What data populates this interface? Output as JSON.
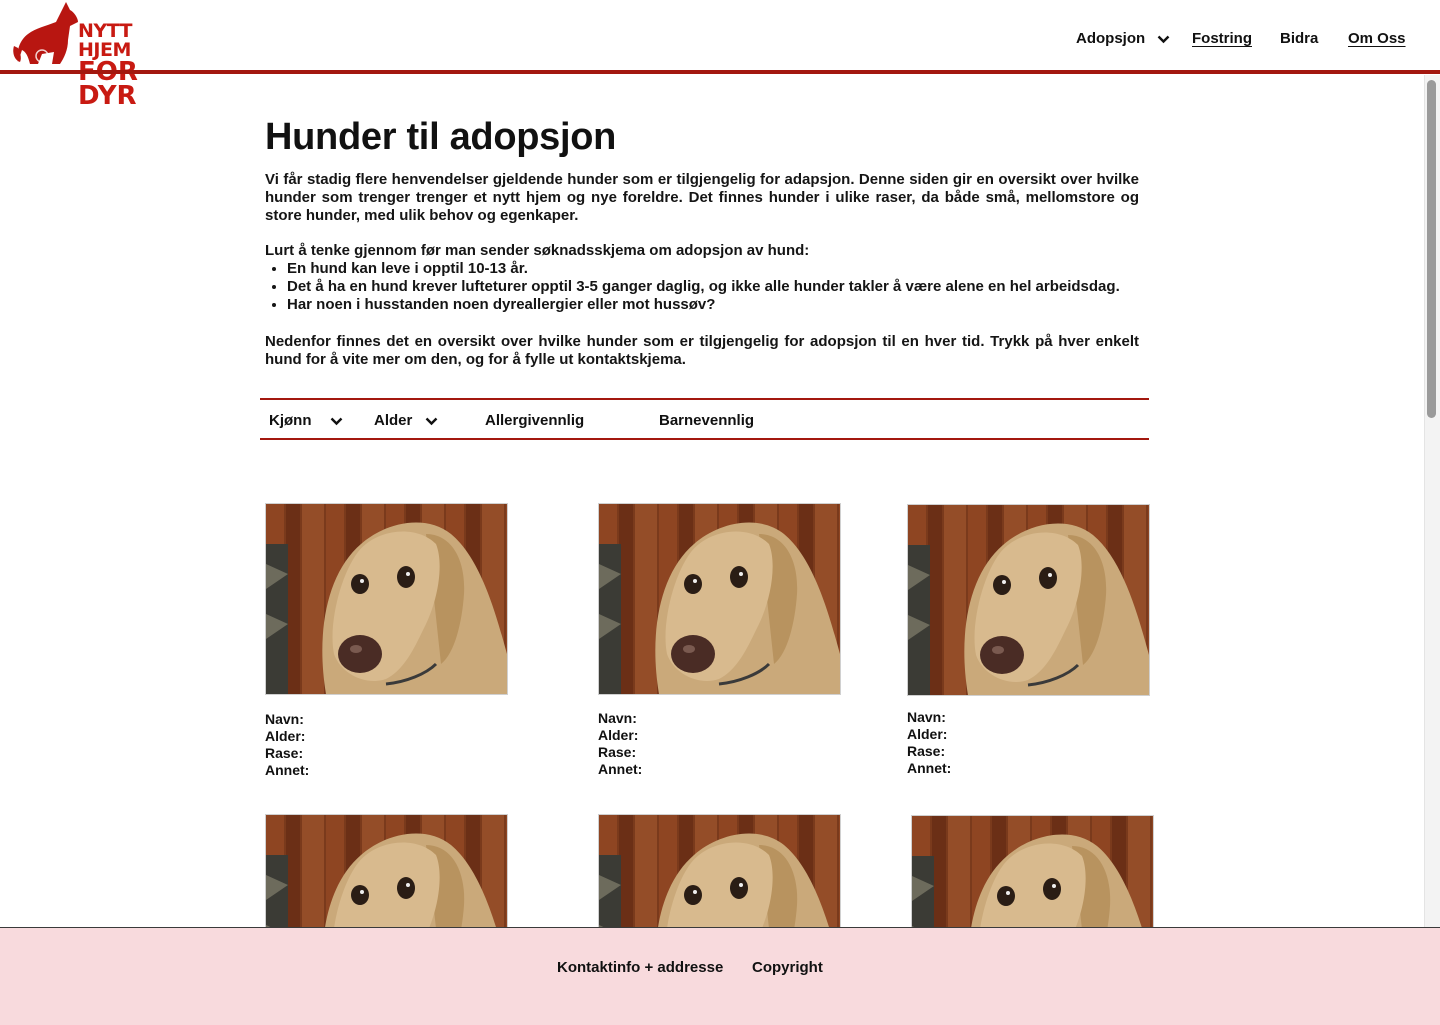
{
  "header": {
    "logo_line1": "NYTT HJEM",
    "logo_line2": "FOR DYR",
    "nav": {
      "adopsjon": "Adopsjon",
      "fostring": "Fostring",
      "bidra": "Bidra",
      "om_oss": "Om Oss"
    }
  },
  "page": {
    "title": "Hunder til adopsjon",
    "intro": "Vi får stadig flere henvendelser gjeldende hunder som er tilgjengelig for adapsjon. Denne siden gir en oversikt over hvilke hunder som trenger trenger et nytt hjem og nye foreldre. Det finnes hunder i ulike raser, da både små, mellomstore og store hunder, med ulik behov og egenkaper.",
    "list_heading": "Lurt å tenke gjennom før man sender søknadsskjema om adopsjon av hund:",
    "list_items": [
      "En hund kan leve i opptil 10-13 år.",
      "Det å ha en hund krever lufteturer opptil 3-5 ganger daglig, og ikke alle hunder takler å være alene en hel arbeidsdag.",
      "Har noen i husstanden noen dyreallergier eller mot hussøv?"
    ],
    "outro": "Nedenfor finnes det en oversikt over hvilke hunder som er tilgjengelig for adopsjon til en hver tid. Trykk på hver enkelt hund for å vite mer om den, og for å fylle ut kontaktskjema."
  },
  "filters": {
    "kjonn": "Kjønn",
    "alder": "Alder",
    "allergivennlig": "Allergivennlig",
    "barnevennlig": "Barnevennlig"
  },
  "dog_fields": {
    "navn": "Navn:",
    "alder": "Alder:",
    "rase": "Rase:",
    "annet": "Annet:"
  },
  "footer": {
    "kontakt": "Kontaktinfo + addresse",
    "copyright": "Copyright"
  },
  "colors": {
    "accent": "#a3180f",
    "logo_red": "#c81a12",
    "footer_bg": "#f8dadd"
  },
  "icons": [
    "dog-logo-icon",
    "chevron-down-icon"
  ]
}
